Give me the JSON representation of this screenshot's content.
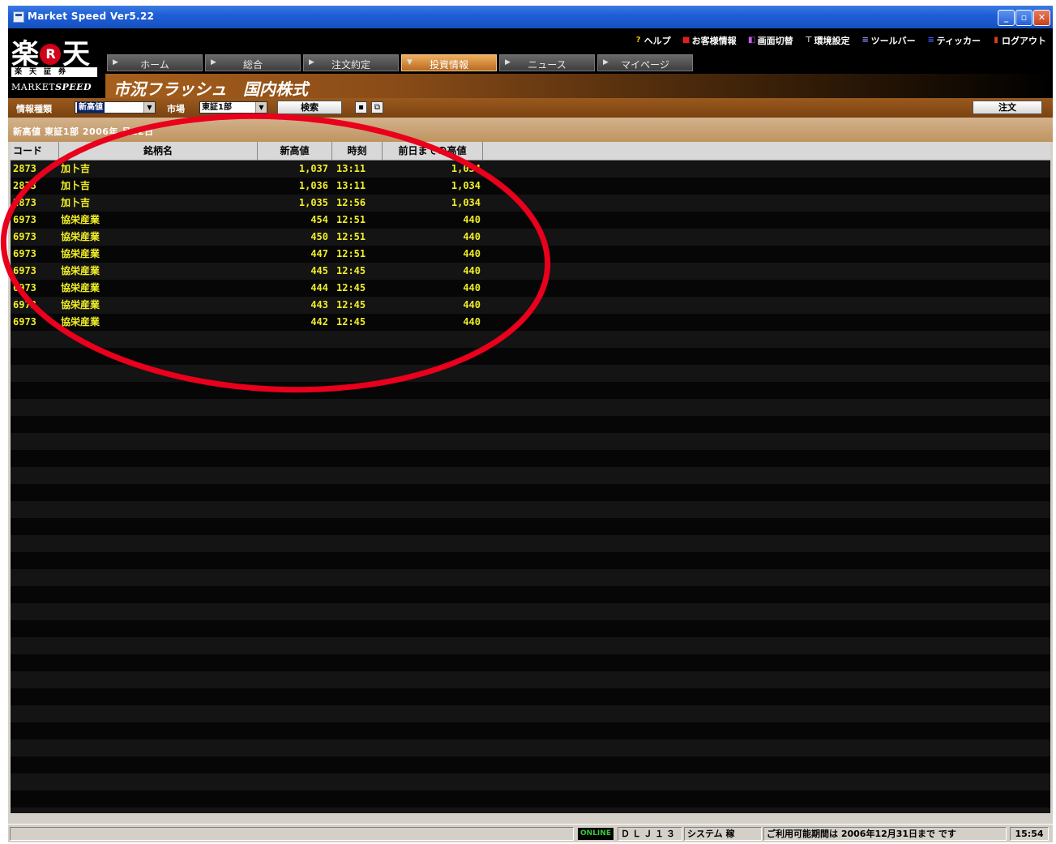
{
  "window": {
    "title": "Market Speed Ver5.22"
  },
  "logo": {
    "brand": "楽天",
    "brand_r": "R",
    "brand_tail": "天",
    "sub": "楽天証券",
    "product_a": "MARKET",
    "product_b": "SPEED"
  },
  "toplinks": [
    {
      "icon": "help-icon",
      "label": "ヘルプ"
    },
    {
      "icon": "customer-info-icon",
      "label": "お客様情報"
    },
    {
      "icon": "screen-switch-icon",
      "label": "画面切替"
    },
    {
      "icon": "settings-icon",
      "label": "環境設定"
    },
    {
      "icon": "toolbar-icon",
      "label": "ツールバー"
    },
    {
      "icon": "ticker-icon",
      "label": "ティッカー"
    },
    {
      "icon": "logout-icon",
      "label": "ログアウト"
    }
  ],
  "tabs": [
    {
      "label": "ホーム",
      "active": false
    },
    {
      "label": "総合",
      "active": false
    },
    {
      "label": "注文約定",
      "active": false
    },
    {
      "label": "投資情報",
      "active": true
    },
    {
      "label": "ニュース",
      "active": false
    },
    {
      "label": "マイページ",
      "active": false
    }
  ],
  "page_title": "市況フラッシュ　国内株式",
  "toolbar": {
    "info_type_label": "情報種類",
    "info_type_value": "新高値",
    "market_label": "市場",
    "market_value": "東証1部",
    "search_label": "検索",
    "order_label": "注文"
  },
  "infobar": {
    "text": "新高値 東証1部 2006年  月12日"
  },
  "table": {
    "columns": [
      "コード",
      "銘柄名",
      "新高値",
      "時刻",
      "前日までの高値"
    ],
    "rows": [
      [
        "2873",
        "加卜吉",
        "1,037",
        "13:11",
        "1,034"
      ],
      [
        "2873",
        "加卜吉",
        "1,036",
        "13:11",
        "1,034"
      ],
      [
        "2873",
        "加卜吉",
        "1,035",
        "12:56",
        "1,034"
      ],
      [
        "6973",
        "協栄産業",
        "454",
        "12:51",
        "440"
      ],
      [
        "6973",
        "協栄産業",
        "450",
        "12:51",
        "440"
      ],
      [
        "6973",
        "協栄産業",
        "447",
        "12:51",
        "440"
      ],
      [
        "6973",
        "協栄産業",
        "445",
        "12:45",
        "440"
      ],
      [
        "6973",
        "協栄産業",
        "444",
        "12:45",
        "440"
      ],
      [
        "6973",
        "協栄産業",
        "443",
        "12:45",
        "440"
      ],
      [
        "6973",
        "協栄産業",
        "442",
        "12:45",
        "440"
      ]
    ]
  },
  "statusbar": {
    "online": "ONLINE",
    "account": "ＤＬＪ１３",
    "system": "システム 稼",
    "notice": "ご利用可能期間は 2006年12月31日まで です",
    "time": "15:54"
  },
  "colors": {
    "row_text": "#f0ee28",
    "annotation": "#e8001c",
    "accent_tab": "#d98a3a"
  }
}
